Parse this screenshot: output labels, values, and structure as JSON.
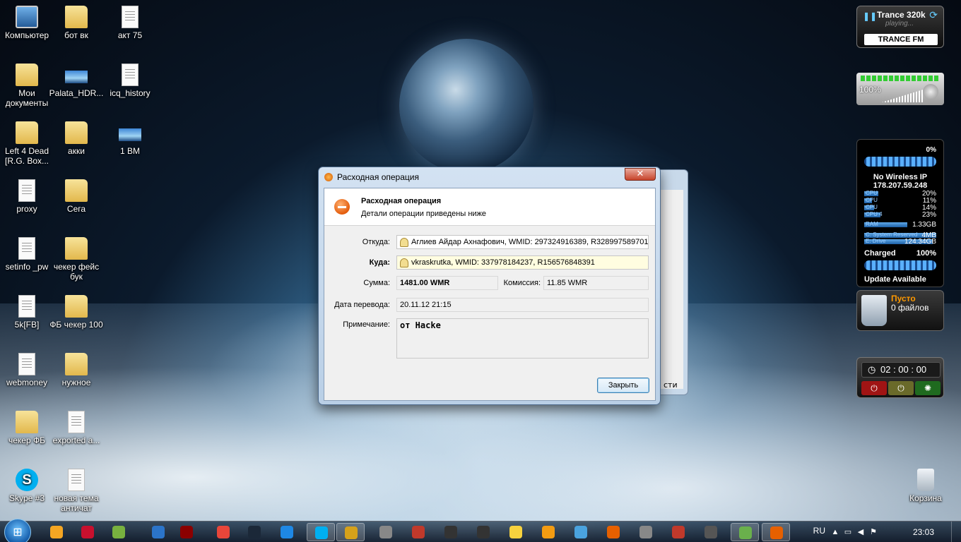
{
  "desktop": {
    "icons": [
      {
        "label": "Компьютер",
        "kind": "pc"
      },
      {
        "label": "бот вк",
        "kind": "folder"
      },
      {
        "label": "акт 75",
        "kind": "doc"
      },
      {
        "label": "Мои документы",
        "kind": "folder"
      },
      {
        "label": "Palata_HDR...",
        "kind": "image"
      },
      {
        "label": "icq_history",
        "kind": "doc"
      },
      {
        "label": "Left 4 Dead [R.G. Box...",
        "kind": "folder"
      },
      {
        "label": "акки",
        "kind": "folder"
      },
      {
        "label": "1 ВМ",
        "kind": "image"
      },
      {
        "label": "proxy",
        "kind": "doc"
      },
      {
        "label": "Сега",
        "kind": "folder"
      },
      {
        "label": "setinfo _pw",
        "kind": "doc"
      },
      {
        "label": "чекер фейс бук",
        "kind": "folder"
      },
      {
        "label": "5k[FB]",
        "kind": "doc"
      },
      {
        "label": "ФБ чекер 100",
        "kind": "folder"
      },
      {
        "label": "webmoney",
        "kind": "doc"
      },
      {
        "label": "нужное",
        "kind": "folder"
      },
      {
        "label": "чекер ФБ",
        "kind": "folder"
      },
      {
        "label": "exported a...",
        "kind": "doc"
      },
      {
        "label": "Skype #3",
        "kind": "skype"
      },
      {
        "label": "новая тема античат",
        "kind": "doc"
      },
      {
        "label": "Корзина",
        "kind": "recycle"
      }
    ]
  },
  "gadgets": {
    "radio": {
      "station": "Trance 320k",
      "status": "playing...",
      "logo": "TRANCE FM"
    },
    "volume": {
      "percent": "100%"
    },
    "system": {
      "wireless_percent": "0%",
      "wireless_label": "No Wireless IP",
      "ip": "178.207.59.248",
      "cpus": [
        {
          "label": "CPU",
          "value": "20%",
          "level": 0.2
        },
        {
          "label": "CPU",
          "value": "11%",
          "level": 0.11
        },
        {
          "label": "CPU",
          "value": "14%",
          "level": 0.14
        },
        {
          "label": "CPU 4",
          "value": "23%",
          "level": 0.23
        }
      ],
      "ram_label": "RAM",
      "ram_value": "1.33GB",
      "drives": [
        {
          "label": "C: System Reserved",
          "value": "4MB"
        },
        {
          "label": "E: Drive",
          "value": "124.34GB"
        }
      ],
      "battery_label": "Charged",
      "battery_value": "100%",
      "update": "Update Available"
    },
    "bin": {
      "title": "Пусто",
      "files": "0 файлов"
    },
    "timer": {
      "time": "02 : 00 : 00"
    }
  },
  "dialog": {
    "title": "Расходная операция",
    "header_title": "Расходная операция",
    "header_subtitle": "Детали операции приведены ниже",
    "from_label": "Откуда:",
    "from_value": "Аглиев Айдар Ахнафович, WMID: 297324916389, R328997589701",
    "to_label": "Куда:",
    "to_value": "vkraskrutka, WMID: 337978184237, R156576848391",
    "sum_label": "Сумма:",
    "sum_value": "1481.00 WMR",
    "fee_label": "Комиссия:",
    "fee_value": "11.85 WMR",
    "date_label": "Дата перевода:",
    "date_value": "20.11.12 21:15",
    "note_label": "Примечание:",
    "note_value": "от Hacke",
    "close_button": "Закрыть"
  },
  "back_window": {
    "fragment": "сти"
  },
  "taskbar": {
    "language": "RU",
    "clock": "23:03",
    "items": [
      "avast",
      "filezilla",
      "utorrent",
      "browser",
      "video",
      "chrome",
      "steam",
      "notes",
      "skype",
      "webmoney",
      "unity",
      "opera",
      "winamp",
      "game",
      "smile",
      "paint",
      "orbit",
      "firefox",
      "bug",
      "pj",
      "calc",
      "game2",
      "firefox2"
    ]
  }
}
